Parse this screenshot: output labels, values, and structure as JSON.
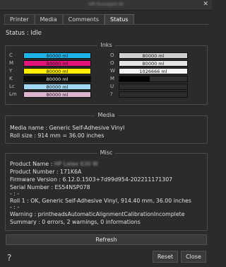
{
  "window": {
    "title": "HP-Sunspot-W",
    "close_glyph": "✕"
  },
  "tabs": [
    {
      "label": "Printer"
    },
    {
      "label": "Media"
    },
    {
      "label": "Comments"
    },
    {
      "label": "Status",
      "active": true
    }
  ],
  "status": {
    "text": "Status  :  Idle"
  },
  "inks": {
    "title": "Inks",
    "left": [
      {
        "label": "C",
        "value": "80000 ml",
        "color": "#1fb3ea",
        "level": 1.0
      },
      {
        "label": "M",
        "value": "80000 ml",
        "color": "#e2137b",
        "level": 1.0
      },
      {
        "label": "Y",
        "value": "80000 ml",
        "color": "#ffee00",
        "level": 1.0
      },
      {
        "label": "K",
        "value": "80000 ml",
        "color": "#0b0b0b",
        "level": 1.0,
        "text_color": "#e8e8e8"
      },
      {
        "label": "Lc",
        "value": "80000 ml",
        "color": "#9fd7f4",
        "level": 1.0
      },
      {
        "label": "Lm",
        "value": "80000 ml",
        "color": "#dcb4cf",
        "level": 1.0
      }
    ],
    "right": [
      {
        "label": "O",
        "value": "80000 ml",
        "color": "#cfcfcf",
        "level": 1.0
      },
      {
        "label": "O",
        "value": "80000 ml",
        "color": "#e6e6e6",
        "level": 1.0
      },
      {
        "label": "W",
        "value": "1026666 ml",
        "color": "#f4f4f4",
        "level": 1.0
      },
      {
        "label": "M",
        "value": "",
        "color": "#050505",
        "level": 0.45,
        "track_color": "#2f2f2f"
      },
      {
        "label": "U",
        "value": "",
        "color": "#2b2b2b",
        "level": 0.0,
        "track_color": "#2b2b2b"
      },
      {
        "label": "?",
        "value": "",
        "color": "#2b2b2b",
        "level": 0.0,
        "track_color": "#2b2b2b"
      }
    ]
  },
  "media": {
    "title": "Media",
    "name_line": "Media name : Generic Self-Adhesive Vinyl",
    "roll_line": "Roll size : 914 mm = 36.00 inches"
  },
  "misc": {
    "title": "Misc",
    "product_name_prefix": "Product Name : ",
    "product_name_value": "HP Latex 630 W",
    "product_number": "Product Number : 171K6A",
    "firmware": "Firmware Version : 6.12.0.1503+7d99d954-202211171307",
    "serial": "Serial Number : ES54NSP078",
    "sep1": "- : -",
    "roll1": "Roll 1 : OK, Generic Self-Adhesive Vinyl, 914.40 mm, 36.00 inches",
    "sep2": "- : -",
    "warning": "Warning : printheadsAutomaticAlignmentCalibrationIncomplete",
    "summary": "Summary : 0 errors, 2 warnings, 0 informations"
  },
  "buttons": {
    "refresh": "Refresh",
    "reset": "Reset",
    "close": "Close",
    "help": "?"
  }
}
